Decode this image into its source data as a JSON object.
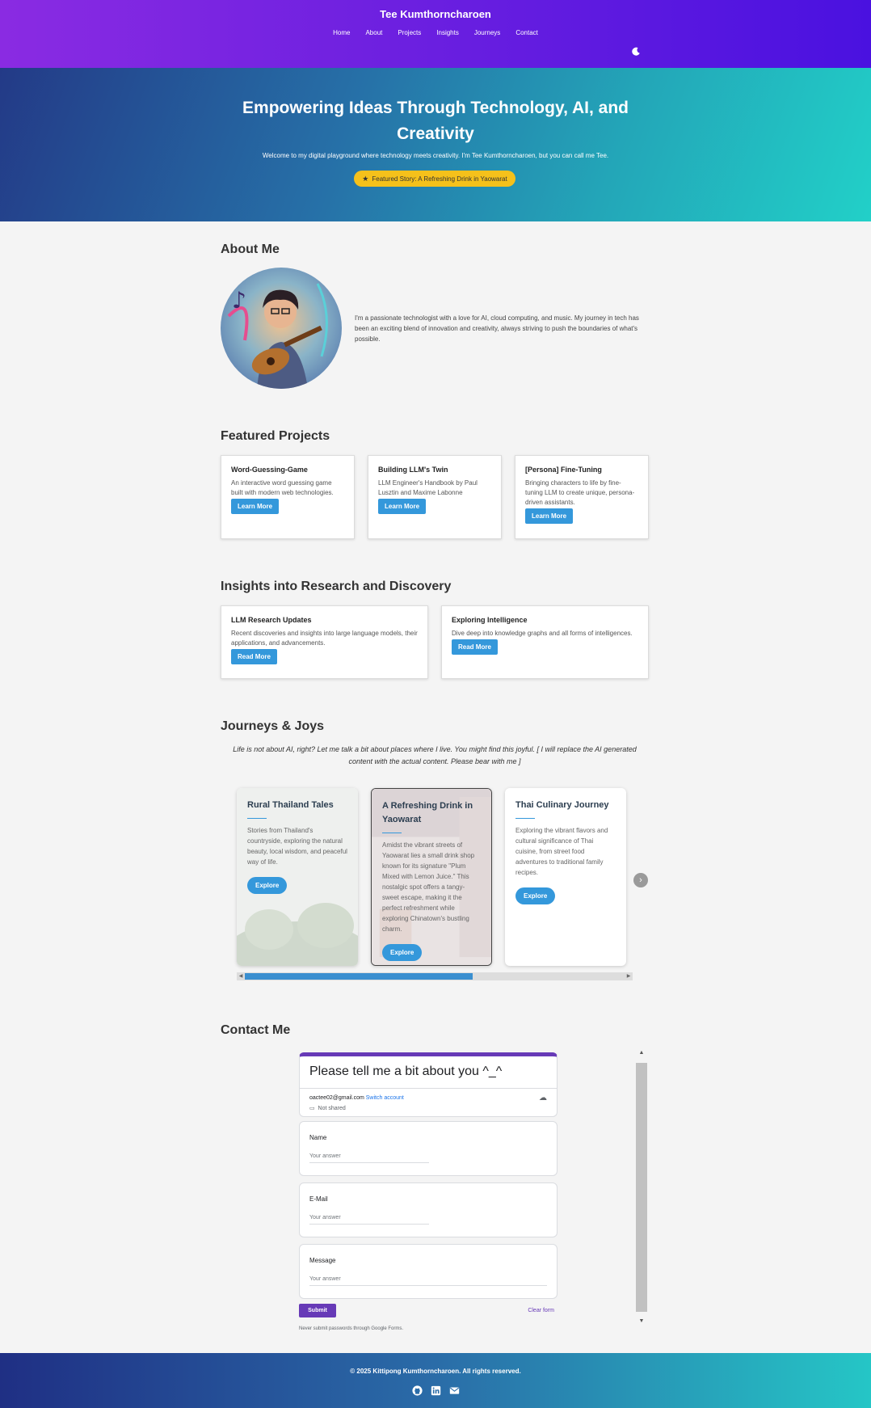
{
  "header": {
    "site_title": "Tee Kumthorncharoen",
    "nav": [
      "Home",
      "About",
      "Projects",
      "Insights",
      "Journeys",
      "Contact"
    ],
    "theme_icon": "moon-icon"
  },
  "hero": {
    "title": "Empowering Ideas Through Technology, AI, and Creativity",
    "subtitle": "Welcome to my digital playground where technology meets creativity. I'm Tee Kumthorncharoen, but you can call me Tee.",
    "featured_label": "Featured Story: A Refreshing Drink in Yaowarat"
  },
  "about": {
    "title": "About Me",
    "text": "I'm a passionate technologist with a love for AI, cloud computing, and music. My journey in tech has been an exciting blend of innovation and creativity, always striving to push the boundaries of what's possible."
  },
  "projects": {
    "title": "Featured Projects",
    "items": [
      {
        "title": "Word-Guessing-Game",
        "desc": "An interactive word guessing game built with modern web technologies.",
        "button": "Learn More"
      },
      {
        "title": "Building LLM's Twin",
        "desc": "LLM Engineer's Handbook by Paul Lusztin and Maxime Labonne",
        "button": "Learn More"
      },
      {
        "title": "[Persona] Fine-Tuning",
        "desc": "Bringing characters to life by fine-tuning LLM to create unique, persona-driven assistants.",
        "button": "Learn More"
      }
    ]
  },
  "insights": {
    "title": "Insights into Research and Discovery",
    "items": [
      {
        "title": "LLM Research Updates",
        "desc": "Recent discoveries and insights into large language models, their applications, and advancements.",
        "button": "Read More"
      },
      {
        "title": "Exploring Intelligence",
        "desc": "Dive deep into knowledge graphs and all forms of intelligences.",
        "button": "Read More"
      }
    ]
  },
  "journeys": {
    "title": "Journeys & Joys",
    "intro": "Life is not about AI, right? Let me talk a bit about places where I live. You might find this joyful. [ I will replace the AI generated content with the actual content. Please bear with me ]",
    "items": [
      {
        "title": "Rural Thailand Tales",
        "desc": "Stories from Thailand's countryside, exploring the natural beauty, local wisdom, and peaceful way of life.",
        "button": "Explore"
      },
      {
        "title": "A Refreshing Drink in Yaowarat",
        "desc": "Amidst the vibrant streets of Yaowarat lies a small drink shop known for its signature \"Plum Mixed with Lemon Juice.\" This nostalgic spot offers a tangy-sweet escape, making it the perfect refreshment while exploring Chinatown's bustling charm.",
        "button": "Explore"
      },
      {
        "title": "Thai Culinary Journey",
        "desc": "Exploring the vibrant flavors and cultural significance of Thai cuisine, from street food adventures to traditional family recipes.",
        "button": "Explore"
      }
    ],
    "scroll_progress": 0.6
  },
  "contact": {
    "title": "Contact Me",
    "form": {
      "title": "Please tell me a bit about you ^_^",
      "email": "oactee02@gmail.com",
      "switch_account": "Switch account",
      "not_shared": "Not shared",
      "fields": [
        {
          "label": "Name",
          "placeholder": "Your answer"
        },
        {
          "label": "E-Mail",
          "placeholder": "Your answer"
        },
        {
          "label": "Message",
          "placeholder": "Your answer"
        }
      ],
      "submit": "Submit",
      "clear": "Clear form",
      "never_submit": "Never submit passwords through Google Forms."
    }
  },
  "footer": {
    "copyright": "© 2025 Kittipong Kumthorncharoen. All rights reserved.",
    "icons": [
      "github-icon",
      "linkedin-icon",
      "email-icon"
    ]
  },
  "colors": {
    "header_gradient": [
      "#8a2be2",
      "#4a11e0"
    ],
    "hero_gradient": [
      "#233a87",
      "#22d0c8"
    ],
    "accent": "#3498db",
    "featured_pill": "#f5c11b",
    "form_accent": "#673ab7"
  }
}
